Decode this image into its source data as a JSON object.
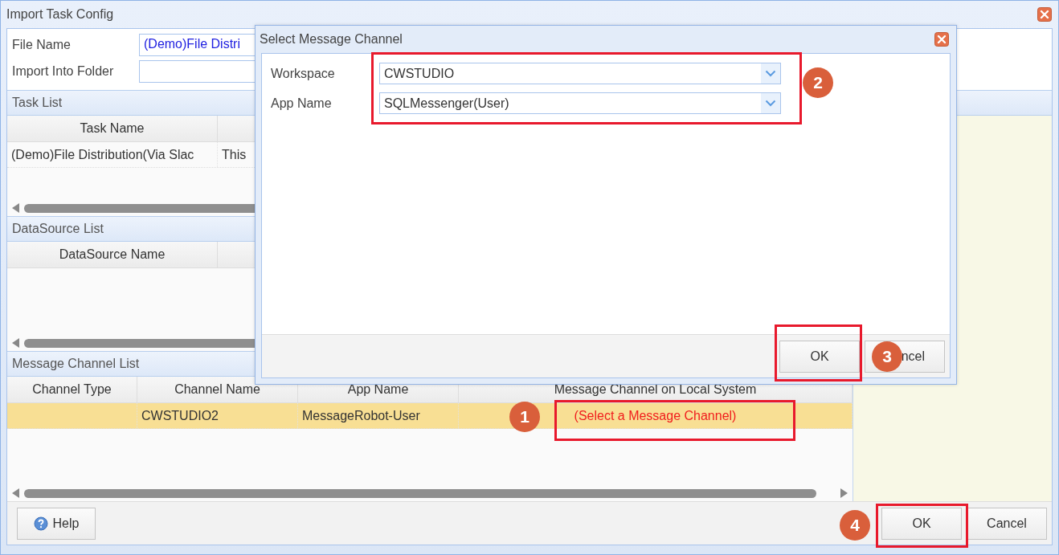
{
  "window": {
    "title": "Import Task Config"
  },
  "form": [
    {
      "label": "File Name",
      "value": "(Demo)File Distri"
    },
    {
      "label": "Import Into Folder"
    }
  ],
  "task_list": {
    "title": "Task List",
    "columns": [
      "Task Name"
    ],
    "rows": [
      {
        "cells": [
          "(Demo)File Distribution(Via Slac",
          "This"
        ],
        "selected": false
      }
    ]
  },
  "datasource_list": {
    "title": "DataSource List",
    "columns": [
      "DataSource Name"
    ]
  },
  "message_channel_list": {
    "title": "Message Channel List",
    "columns": [
      "Channel Type",
      "Channel Name",
      "App Name",
      "Message Channel on Local System"
    ],
    "rows": [
      {
        "channel_name": "CWSTUDIO2",
        "app_name": "MessageRobot-User",
        "local_channel": "(Select a Message Channel)",
        "selected": true
      }
    ]
  },
  "buttons": [
    {
      "kind": "help",
      "label": "Help"
    },
    {
      "kind": "ok",
      "label": "OK"
    },
    {
      "kind": "cancel",
      "label": "Cancel"
    }
  ],
  "dialog": {
    "title": "Select Message Channel",
    "fields": [
      {
        "label": "Workspace",
        "value": "CWSTUDIO"
      },
      {
        "label": "App Name",
        "value": "SQLMessenger(User)"
      }
    ],
    "buttons": [
      {
        "label": "OK"
      },
      {
        "label": "ncel"
      }
    ]
  },
  "annotations": [
    {
      "number": "1"
    },
    {
      "number": "2"
    },
    {
      "number": "3"
    },
    {
      "number": "4"
    }
  ]
}
